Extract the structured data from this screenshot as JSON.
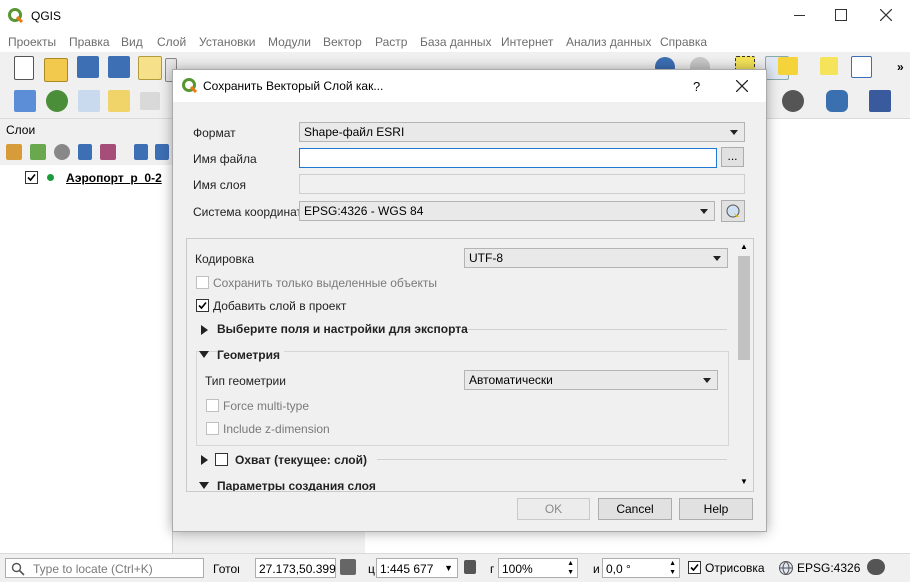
{
  "app": {
    "title": "QGIS"
  },
  "menu": [
    "Проекты",
    "Правка",
    "Вид",
    "Слой",
    "Установки",
    "Модули",
    "Вектор",
    "Растр",
    "База данных",
    "Интернет",
    "Анализ данных",
    "Справка"
  ],
  "layers_panel": {
    "title": "Слои",
    "layer_name": "Аэропорт_р_0-2"
  },
  "dialog": {
    "title": "Сохранить Векторый Слой как...",
    "help": "?",
    "format_label": "Формат",
    "format_value": "Shape-файл ESRI",
    "filename_label": "Имя файла",
    "filename_value": "",
    "browse_label": "...",
    "layername_label": "Имя слоя",
    "crs_label": "Система координат",
    "crs_value": "EPSG:4326 - WGS 84",
    "encoding_label": "Кодировка",
    "encoding_value": "UTF-8",
    "save_selected_label": "Сохранить только выделенные объекты",
    "add_to_project_label": "Добавить слой в проект",
    "fields_section": "Выберите поля и настройки для экспорта",
    "geometry_section": "Геометрия",
    "geometry_type_label": "Тип геометрии",
    "geometry_type_value": "Автоматически",
    "force_multi_label": "Force multi-type",
    "include_z_label": "Include z-dimension",
    "extent_section": "Охват (текущее: слой)",
    "layer_options_section": "Параметры создания слоя",
    "ok_label": "OK",
    "cancel_label": "Cancel",
    "help_label": "Help"
  },
  "status": {
    "locate_placeholder": "Type to locate (Ctrl+K)",
    "coord_label": "Готов",
    "coord_value": "27.173,50.399",
    "scale_label": "ц",
    "scale_value": "1:445 677",
    "magnifier_label": "г",
    "magnifier_value": "100%",
    "rotation_label": "и",
    "rotation_value": "0,0 °",
    "render_label": "Отрисовка",
    "crs_value": "EPSG:4326"
  }
}
